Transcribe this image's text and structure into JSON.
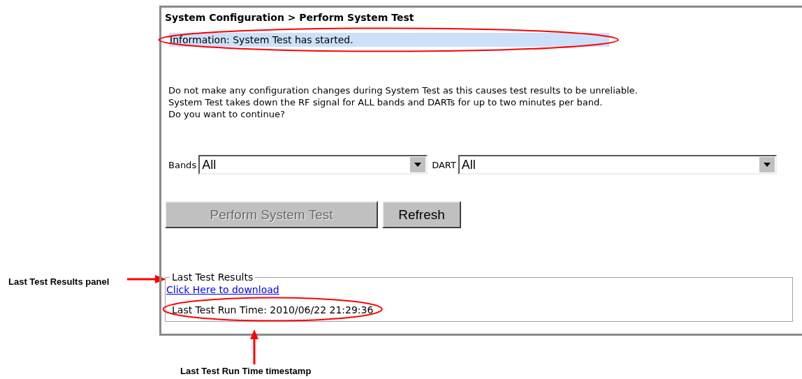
{
  "breadcrumb": "System Configuration > Perform System Test",
  "info": {
    "text": "Information: System Test has started.",
    "highlighted": true
  },
  "warning_lines": [
    "Do not make any configuration changes during System Test as this causes test results to be unreliable.",
    "System Test takes down the RF signal for ALL bands and DARTs for up to two minutes per band.",
    "Do you want to continue?"
  ],
  "selects": [
    {
      "label": "Bands",
      "value": "All"
    },
    {
      "label": "DART",
      "value": "All"
    }
  ],
  "buttons": [
    {
      "label": "Perform System Test",
      "disabled": true
    },
    {
      "label": "Refresh",
      "disabled": false
    }
  ],
  "last_results": {
    "legend": "Last Test Results",
    "link": "Click Here to download",
    "run_time": "Last Test Run Time: 2010/06/22 21:29:36",
    "highlighted": true
  },
  "annotations": [
    {
      "kind": "left",
      "text": "Last Test Results panel"
    },
    {
      "kind": "bottom",
      "text": "Last Test Run Time timestamp"
    }
  ]
}
